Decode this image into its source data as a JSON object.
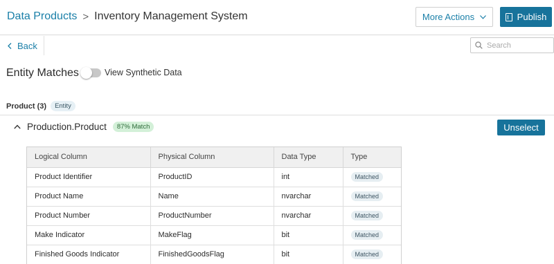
{
  "header": {
    "breadcrumb_root": "Data Products",
    "breadcrumb_sep": ">",
    "breadcrumb_current": "Inventory Management System",
    "more_actions_label": "More Actions",
    "publish_label": "Publish"
  },
  "subbar": {
    "back_label": "Back",
    "search_placeholder": "Search"
  },
  "page": {
    "title": "Entity Matches",
    "toggle_label": "View Synthetic Data",
    "toggle_on": false
  },
  "group": {
    "title": "Product (3)",
    "badge": "Entity"
  },
  "entity": {
    "name": "Production.Product",
    "match_badge": "87% Match",
    "unselect_label": "Unselect"
  },
  "table": {
    "columns": [
      "Logical Column",
      "Physical Column",
      "Data Type",
      "Type"
    ],
    "rows": [
      {
        "logical": "Product Identifier",
        "physical": "ProductID",
        "dtype": "int",
        "type": "Matched"
      },
      {
        "logical": "Product Name",
        "physical": "Name",
        "dtype": "nvarchar",
        "type": "Matched"
      },
      {
        "logical": "Product Number",
        "physical": "ProductNumber",
        "dtype": "nvarchar",
        "type": "Matched"
      },
      {
        "logical": "Make Indicator",
        "physical": "MakeFlag",
        "dtype": "bit",
        "type": "Matched"
      },
      {
        "logical": "Finished Goods Indicator",
        "physical": "FinishedGoodsFlag",
        "dtype": "bit",
        "type": "Matched"
      }
    ]
  },
  "colors": {
    "accent": "#17739b",
    "link": "#1a7fa8",
    "match_badge_bg": "#d3f0d8"
  }
}
